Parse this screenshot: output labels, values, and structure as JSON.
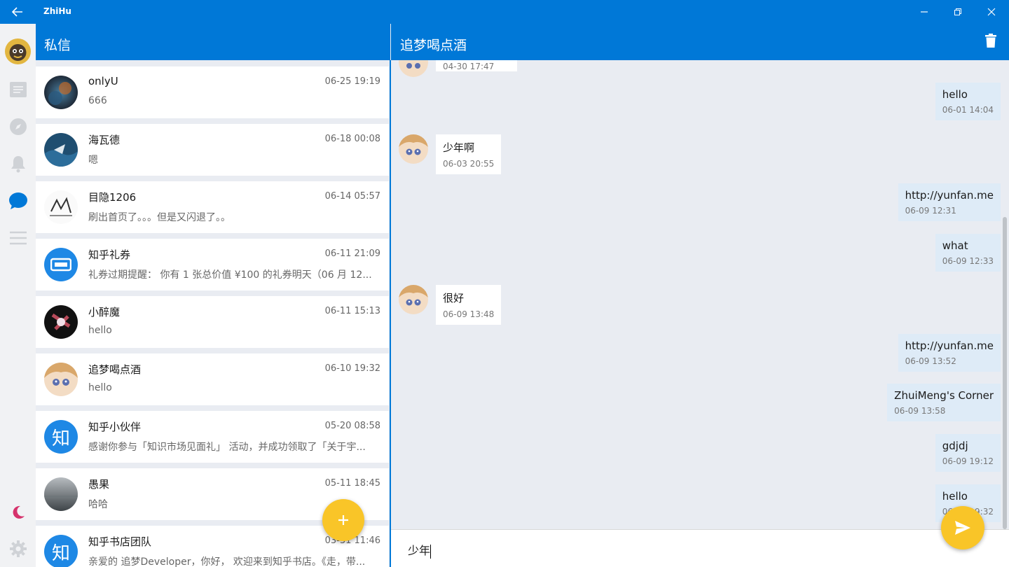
{
  "app": {
    "title": "ZhiHu"
  },
  "colors": {
    "accent": "#0078d7",
    "fab": "#f9c528",
    "sent_bubble": "#deebf7"
  },
  "rail": {
    "icons": [
      "avatar",
      "feed-icon",
      "compass-icon",
      "bell-icon",
      "chat-icon",
      "menu-icon",
      "moon-icon",
      "gear-icon"
    ],
    "active": "chat-icon"
  },
  "list": {
    "title": "私信",
    "conversations": [
      {
        "name": "onlyU",
        "time": "06-25 19:19",
        "preview": "666"
      },
      {
        "name": "海瓦德",
        "time": "06-18 00:08",
        "preview": "嗯"
      },
      {
        "name": "目隐1206",
        "time": "06-14 05:57",
        "preview": "刷出首页了。。。但是又闪退了。。"
      },
      {
        "name": "知乎礼券",
        "time": "06-11 21:09",
        "preview": " 礼券过期提醒： 你有 1 张总价值 ¥100 的礼券明天（06 月 12..."
      },
      {
        "name": "小醉魔",
        "time": "06-11 15:13",
        "preview": "hello"
      },
      {
        "name": "追梦喝点酒",
        "time": "06-10 19:32",
        "preview": "hello"
      },
      {
        "name": "知乎小伙伴",
        "time": "05-20 08:58",
        "preview": "感谢你参与「知识市场见面礼」 活动，并成功领取了「关于宇..."
      },
      {
        "name": "愚果",
        "time": "05-11 18:45",
        "preview": "哈哈"
      },
      {
        "name": "知乎书店团队",
        "time": "03-31 11:46",
        "preview": "亲爱的 追梦Developer，你好， 欢迎来到知乎书店。《走，带..."
      }
    ],
    "zhi_glyph": "知"
  },
  "chat": {
    "title": "追梦喝点酒",
    "partial_top_time": "04-30 17:47",
    "messages": [
      {
        "side": "sent",
        "text": "hello",
        "time": "06-01 14:04"
      },
      {
        "side": "received",
        "text": "少年啊",
        "time": "06-03 20:55"
      },
      {
        "side": "sent",
        "text": "http://yunfan.me",
        "time": "06-09 12:31"
      },
      {
        "side": "sent",
        "text": "what",
        "time": "06-09 12:33"
      },
      {
        "side": "received",
        "text": "很好",
        "time": "06-09 13:48"
      },
      {
        "side": "sent",
        "text": "http://yunfan.me",
        "time": "06-09 13:52"
      },
      {
        "side": "sent",
        "text": "ZhuiMeng's Corner",
        "time": "06-09 13:58"
      },
      {
        "side": "sent",
        "text": "gdjdj",
        "time": "06-09 19:12"
      },
      {
        "side": "sent",
        "text": "hello",
        "time": "06-09 19:32"
      }
    ],
    "input_value": "少年"
  }
}
